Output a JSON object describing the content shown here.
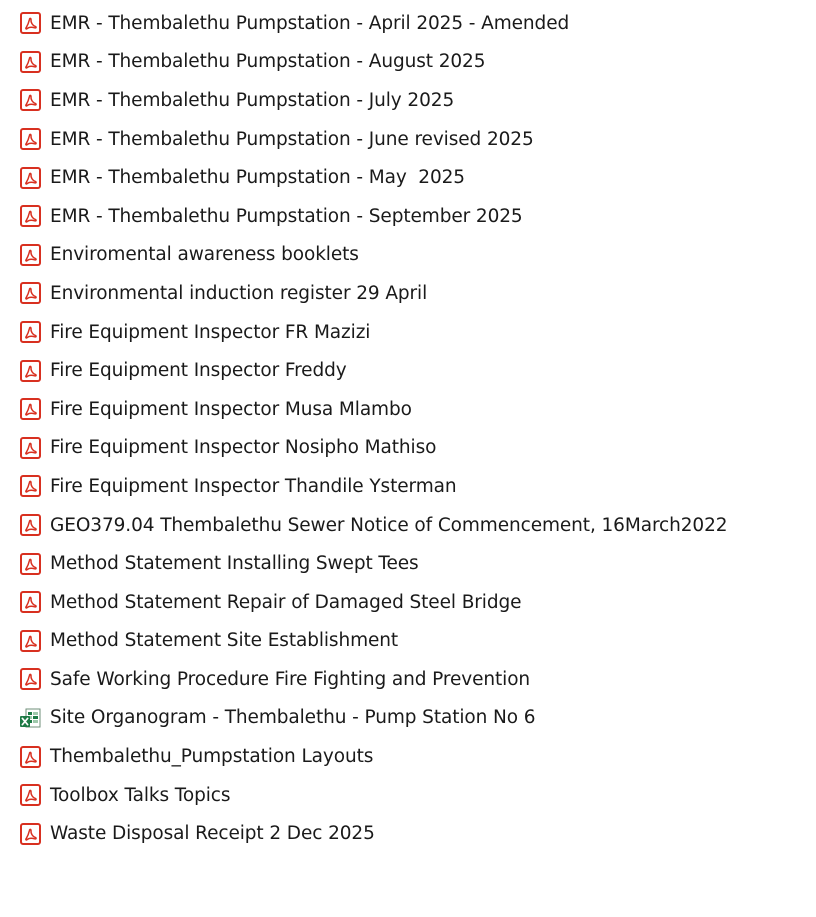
{
  "colors": {
    "pdf_red": "#d83020",
    "excel_green": "#1d7a45",
    "text": "#1a1a1a"
  },
  "files": [
    {
      "name": "EMR - Thembalethu Pumpstation - April 2025 - Amended",
      "icon": "pdf-icon"
    },
    {
      "name": "EMR - Thembalethu Pumpstation - August 2025",
      "icon": "pdf-icon"
    },
    {
      "name": "EMR - Thembalethu Pumpstation - July 2025",
      "icon": "pdf-icon"
    },
    {
      "name": "EMR - Thembalethu Pumpstation - June revised 2025",
      "icon": "pdf-icon"
    },
    {
      "name": "EMR - Thembalethu Pumpstation - May  2025",
      "icon": "pdf-icon"
    },
    {
      "name": "EMR - Thembalethu Pumpstation - September 2025",
      "icon": "pdf-icon"
    },
    {
      "name": "Enviromental awareness booklets",
      "icon": "pdf-icon"
    },
    {
      "name": "Environmental induction register 29 April",
      "icon": "pdf-icon"
    },
    {
      "name": "Fire Equipment Inspector FR Mazizi",
      "icon": "pdf-icon"
    },
    {
      "name": "Fire Equipment Inspector Freddy",
      "icon": "pdf-icon"
    },
    {
      "name": "Fire Equipment Inspector Musa Mlambo",
      "icon": "pdf-icon"
    },
    {
      "name": "Fire Equipment Inspector Nosipho Mathiso",
      "icon": "pdf-icon"
    },
    {
      "name": "Fire Equipment Inspector Thandile Ysterman",
      "icon": "pdf-icon"
    },
    {
      "name": "GEO379.04 Thembalethu Sewer Notice of Commencement, 16March2022",
      "icon": "pdf-icon"
    },
    {
      "name": "Method Statement Installing Swept Tees",
      "icon": "pdf-icon"
    },
    {
      "name": "Method Statement Repair of Damaged Steel Bridge",
      "icon": "pdf-icon"
    },
    {
      "name": "Method Statement Site Establishment",
      "icon": "pdf-icon"
    },
    {
      "name": "Safe Working Procedure Fire Fighting and Prevention",
      "icon": "pdf-icon"
    },
    {
      "name": "Site Organogram - Thembalethu - Pump Station No 6",
      "icon": "excel-icon"
    },
    {
      "name": "Thembalethu_Pumpstation Layouts",
      "icon": "pdf-icon"
    },
    {
      "name": "Toolbox Talks Topics",
      "icon": "pdf-icon"
    },
    {
      "name": "Waste Disposal Receipt 2 Dec 2025",
      "icon": "pdf-icon"
    }
  ]
}
